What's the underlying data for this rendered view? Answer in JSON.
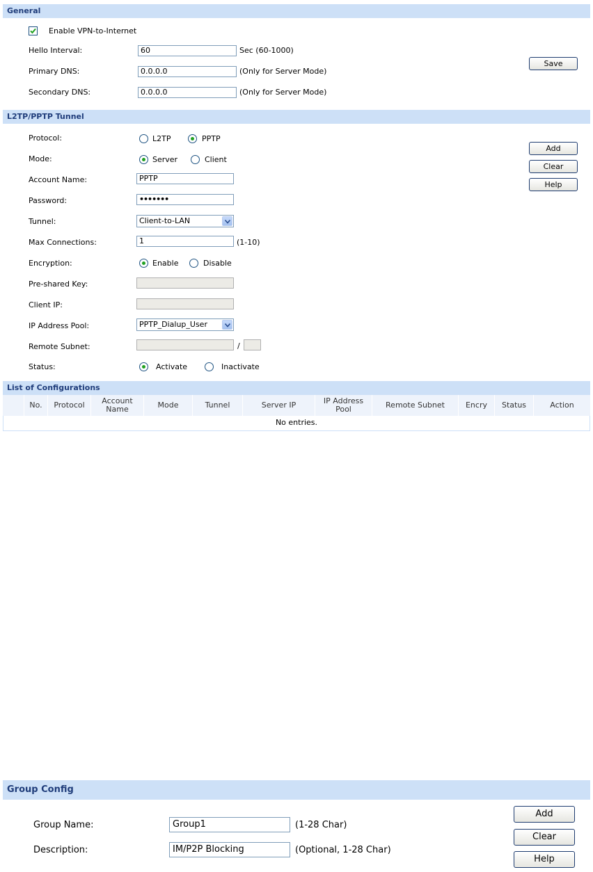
{
  "general": {
    "title": "General",
    "enable_vpn_label": "Enable VPN-to-Internet",
    "enable_vpn_checked": true,
    "hello_interval_label": "Hello Interval:",
    "hello_interval_value": "60",
    "hello_interval_hint": "Sec (60-1000)",
    "primary_dns_label": "Primary DNS:",
    "primary_dns_value": "0.0.0.0",
    "primary_dns_hint": "(Only for Server Mode)",
    "secondary_dns_label": "Secondary DNS:",
    "secondary_dns_value": "0.0.0.0",
    "secondary_dns_hint": "(Only for Server Mode)",
    "save_label": "Save"
  },
  "tunnel": {
    "title": "L2TP/PPTP Tunnel",
    "protocol_label": "Protocol:",
    "protocol_options": [
      "L2TP",
      "PPTP"
    ],
    "protocol_selected": "PPTP",
    "mode_label": "Mode:",
    "mode_options": [
      "Server",
      "Client"
    ],
    "mode_selected": "Server",
    "account_name_label": "Account Name:",
    "account_name_value": "PPTP",
    "password_label": "Password:",
    "password_value": "•••••••",
    "tunnel_label": "Tunnel:",
    "tunnel_value": "Client-to-LAN",
    "max_conn_label": "Max Connections:",
    "max_conn_value": "1",
    "max_conn_hint": "(1-10)",
    "encryption_label": "Encryption:",
    "encryption_options": [
      "Enable",
      "Disable"
    ],
    "encryption_selected": "Enable",
    "psk_label": "Pre-shared Key:",
    "psk_value": "",
    "client_ip_label": "Client IP:",
    "client_ip_value": "",
    "ip_pool_label": "IP Address Pool:",
    "ip_pool_value": "PPTP_Dialup_User",
    "remote_subnet_label": "Remote Subnet:",
    "remote_subnet_sep": "/",
    "status_label": "Status:",
    "status_options": [
      "Activate",
      "Inactivate"
    ],
    "status_selected": "Activate",
    "add_label": "Add",
    "clear_label": "Clear",
    "help_label": "Help"
  },
  "list": {
    "title": "List of Configurations",
    "columns": [
      "No.",
      "Protocol",
      "Account Name",
      "Mode",
      "Tunnel",
      "Server IP",
      "IP Address Pool",
      "Remote Subnet",
      "Encry",
      "Status",
      "Action"
    ],
    "empty_text": "No entries."
  },
  "group": {
    "title": "Group Config",
    "name_label": "Group Name:",
    "name_value": "Group1",
    "name_hint": "(1-28 Char)",
    "desc_label": "Description:",
    "desc_value": "IM/P2P Blocking",
    "desc_hint": "(Optional, 1-28 Char)",
    "add_label": "Add",
    "clear_label": "Clear",
    "help_label": "Help"
  },
  "colors": {
    "section_bg": "#cde0f7",
    "section_text": "#1f3c7a",
    "radio_dot": "#21a121"
  }
}
